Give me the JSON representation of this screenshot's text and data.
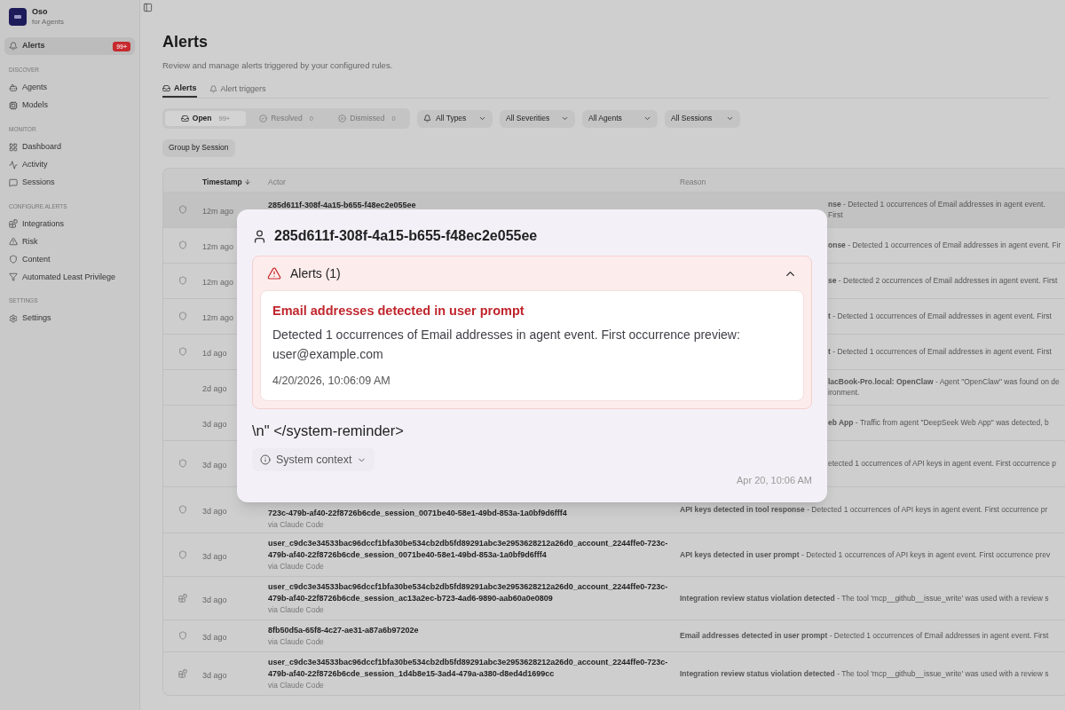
{
  "sidebar": {
    "logo": {
      "title": "Oso",
      "subtitle": "for Agents"
    },
    "sections": [
      {
        "items": [
          {
            "label": "Alerts",
            "badge": "99+",
            "selected": true
          }
        ]
      },
      {
        "heading": "DISCOVER",
        "items": [
          {
            "label": "Agents",
            "selected": false
          },
          {
            "label": "Models",
            "selected": false
          }
        ]
      },
      {
        "heading": "MONITOR",
        "items": [
          {
            "label": "Dashboard",
            "selected": false
          },
          {
            "label": "Activity",
            "selected": false
          },
          {
            "label": "Sessions",
            "selected": false
          }
        ]
      },
      {
        "heading": "CONFIGURE ALERTS",
        "items": [
          {
            "label": "Integrations",
            "selected": false
          },
          {
            "label": "Risk",
            "selected": false
          },
          {
            "label": "Content",
            "selected": false
          },
          {
            "label": "Automated Least Privilege",
            "selected": false
          }
        ]
      },
      {
        "heading": "SETTINGS",
        "items": [
          {
            "label": "Settings",
            "selected": false
          }
        ]
      }
    ]
  },
  "page": {
    "title": "Alerts",
    "subtitle": "Review and manage alerts triggered by your configured rules."
  },
  "tabs": [
    {
      "label": "Alerts",
      "selected": true
    },
    {
      "label": "Alert triggers",
      "selected": false
    }
  ],
  "statuses": [
    {
      "label": "Open",
      "count": "99+",
      "selected": true
    },
    {
      "label": "Resolved",
      "count": "0",
      "selected": false
    },
    {
      "label": "Dismissed",
      "count": "0",
      "selected": false
    }
  ],
  "filters": [
    "All Types",
    "All Severities",
    "All Agents",
    "All Sessions"
  ],
  "group_button": "Group by Session",
  "table": {
    "columns": [
      {
        "label": "Timestamp",
        "sorted": true
      },
      {
        "label": "Actor",
        "sorted": false
      },
      {
        "label": "Reason",
        "sorted": false
      }
    ],
    "rows": [
      {
        "kind": "content",
        "time": "12m ago",
        "actor": "285d611f-308f-4a15-b655-f48ec2e055ee",
        "reason": "**nse** - Detected 1 occurrences of Email addresses in agent event. First",
        "selected": true
      },
      {
        "kind": "content",
        "time": "12m ago",
        "reason": "**onse** - Detected 1 occurrences of Email addresses in agent event. Fir",
        "selected": false
      },
      {
        "kind": "content",
        "time": "12m ago",
        "reason": "**se** - Detected 2 occurrences of Email addresses in agent event. First",
        "selected": false
      },
      {
        "kind": "content",
        "time": "12m ago",
        "reason": "**t** - Detected 1 occurrences of Email addresses in agent event. First",
        "selected": false
      },
      {
        "kind": "content",
        "time": "1d ago",
        "reason": "**t** - Detected 1 occurrences of Email addresses in agent event. First",
        "selected": false
      },
      {
        "kind": "discovery",
        "time": "2d ago",
        "reason": "**lacBook-Pro.local: OpenClaw** - Agent \"OpenClaw\" was found on de ironment.",
        "selected": false
      },
      {
        "kind": "discovery",
        "time": "3d ago",
        "reason": "**eb App** - Traffic from agent \"DeepSeek Web App\" was detected, b",
        "selected": false
      },
      {
        "kind": "content",
        "time": "3d ago",
        "reason": "etected 1 occurrences of API keys in agent event. First occurrence p",
        "selected": false
      },
      {
        "kind": "content",
        "time": "3d ago",
        "actor": "723c-479b-af40-22f8726b6cde_session_0071be40-58e1-49bd-853a-1a0bf9d6fff4",
        "via": "via Claude Code",
        "reason": "**API keys detected in tool response** - Detected 1 occurrences of API keys in agent event. First occurrence pr",
        "selected": false
      },
      {
        "kind": "content",
        "time": "3d ago",
        "actor": "user_c9dc3e34533bac96dccf1bfa30be534cb2db5fd89291abc3e2953628212a26d0_account_2244ffe0-723c-479b-af40-22f8726b6cde_session_0071be40-58e1-49bd-853a-1a0bf9d6fff4",
        "via": "via Claude Code",
        "reason": "**API keys detected in user prompt** - Detected 1 occurrences of API keys in agent event. First occurrence prev",
        "selected": false
      },
      {
        "kind": "integration",
        "time": "3d ago",
        "actor": "user_c9dc3e34533bac96dccf1bfa30be534cb2db5fd89291abc3e2953628212a26d0_account_2244ffe0-723c-479b-af40-22f8726b6cde_session_ac13a2ec-b723-4ad6-9890-aab60a0e0809",
        "via": "via Claude Code",
        "reason": "**Integration review status violation detected** - The tool 'mcp__github__issue_write' was used with a review s",
        "selected": false
      },
      {
        "kind": "content",
        "time": "3d ago",
        "actor": "8fb50d5a-65f8-4c27-ae31-a87a6b97202e",
        "via": "via Claude Code",
        "reason": "**Email addresses detected in user prompt** - Detected 1 occurrences of Email addresses in agent event. First",
        "selected": false
      },
      {
        "kind": "integration",
        "time": "3d ago",
        "actor": "user_c9dc3e34533bac96dccf1bfa30be534cb2db5fd89291abc3e2953628212a26d0_account_2244ffe0-723c-479b-af40-22f8726b6cde_session_1d4b8e15-3ad4-479a-a380-d8ed4d1699cc",
        "via": "via Claude Code",
        "reason": "**Integration review status violation detected** - The tool 'mcp__github__issue_write' was used with a review s",
        "selected": false
      }
    ]
  },
  "modal": {
    "title": "285d611f-308f-4a15-b655-f48ec2e055ee",
    "alerts_panel": {
      "heading": "Alerts (1)",
      "expanded": true,
      "alerts": [
        {
          "title": "Email addresses detected in user prompt",
          "body": "Detected 1 occurrences of Email addresses in agent event. First occurrence preview: user@example.com",
          "time": "4/20/2026, 10:06:09 AM"
        }
      ]
    },
    "message": "\\n\" </system-reminder>",
    "context_button": {
      "label": "System context",
      "expanded": false
    },
    "time": "Apr 20, 10:06 AM"
  }
}
